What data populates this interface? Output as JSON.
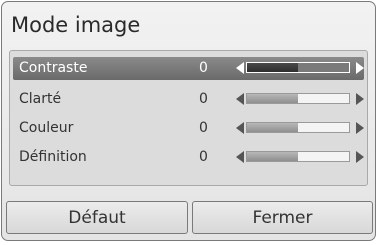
{
  "menu": {
    "title": "Mode image"
  },
  "settings": [
    {
      "label": "Contraste",
      "value": "0",
      "level": 0.5,
      "selected": true
    },
    {
      "label": "Clarté",
      "value": "0",
      "level": 0.5,
      "selected": false
    },
    {
      "label": "Couleur",
      "value": "0",
      "level": 0.5,
      "selected": false
    },
    {
      "label": "Définition",
      "value": "0",
      "level": 0.5,
      "selected": false
    }
  ],
  "buttons": {
    "default_label": "Défaut",
    "close_label": "Fermer"
  }
}
